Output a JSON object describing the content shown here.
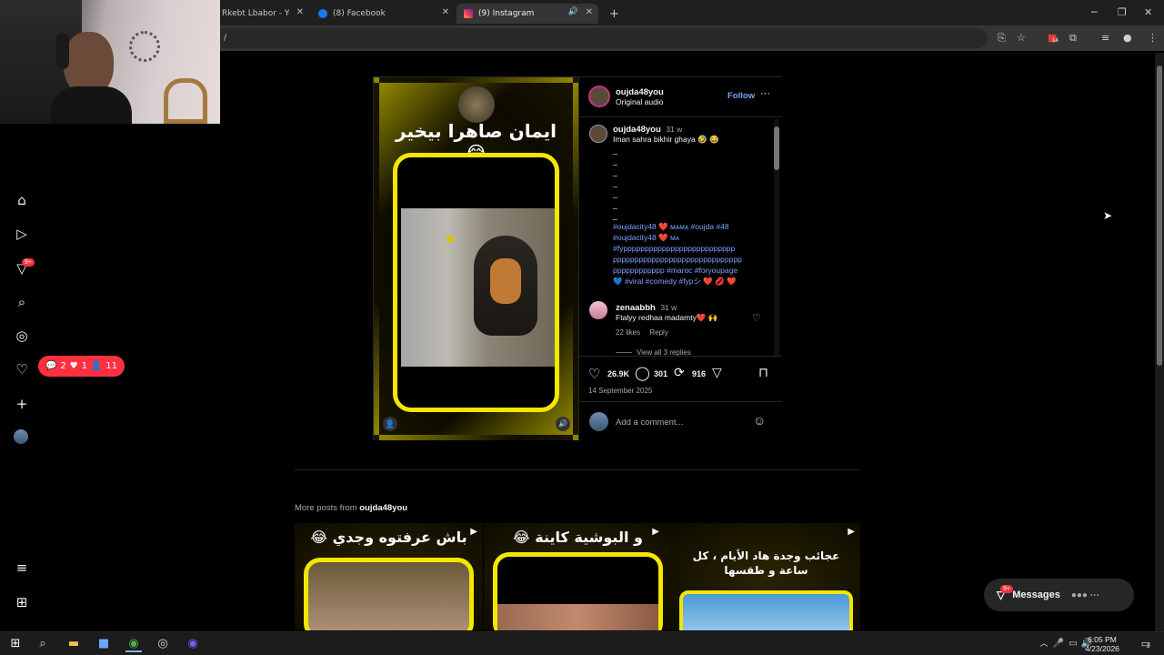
{
  "browser": {
    "tabs": [
      {
        "label": "Rkebt Lbabor - YouTu",
        "icon": "youtube-icon",
        "color": "#ff0000"
      },
      {
        "label": "(8) Facebook",
        "icon": "facebook-icon",
        "color": "#1877f2"
      },
      {
        "label": "(9) Instagram",
        "icon": "instagram-icon",
        "color": "#e1306c"
      }
    ],
    "url": "/",
    "new_tab": "+",
    "extension_badge": "14"
  },
  "sidebar": {
    "notifications_badge": "9+",
    "activity": {
      "comments": "2",
      "likes": "1",
      "follows": "11"
    }
  },
  "reel": {
    "title": "ايمان صاهرا بيخير 😂"
  },
  "post": {
    "username": "oujda48you",
    "audio": "Original audio",
    "follow_label": "Follow",
    "more": "···",
    "caption": {
      "username": "oujda48you",
      "time": "31 w",
      "text": "Iman sahra bikhir ghaya 🤣 😂",
      "dashes": [
        "_",
        "_",
        "_",
        "_",
        "_",
        "_",
        "_"
      ],
      "hashtags_line1": "#oujdacity48 ❤️ ᴍᴀᴍᴀ #oujda #48",
      "hashtags_line2": "#oujdacity48 ❤️ ᴍᴀ",
      "hashtags_line3": "#fypppppppppppppppppppppppppp",
      "hashtags_line4": "pppppppppppppppppppppppppppppp",
      "hashtags_line5": "pppppppppppp #maroc #foryoupage",
      "hashtags_line6": "💙 #viral #comedy #fypシ ❤️ 💋 ❤️"
    },
    "comment": {
      "username": "zenaabbh",
      "time": "31 w",
      "text": "Ftalyy redhaa madamty❤️ 🙌",
      "likes": "22 likes",
      "reply": "Reply",
      "view_replies": "View all 3 replies"
    },
    "stats": {
      "likes": "26.9K",
      "comments": "301",
      "reposts": "916"
    },
    "date": "14 September 2025",
    "add_comment_placeholder": "Add a comment..."
  },
  "more_posts": {
    "heading_prefix": "More posts from ",
    "heading_user": "oujda48you",
    "thumbs": [
      {
        "title": "باش عرفتوه وجدي 😂"
      },
      {
        "title": "و البوشية كاينة 😂"
      },
      {
        "title": "عجائب وجدة هاد الأيام ، كل ساعة و طقسها"
      }
    ]
  },
  "messages": {
    "label": "Messages",
    "badge": "9+"
  },
  "taskbar": {
    "time": "6:05 PM",
    "date": "4/23/2026",
    "notif_count": "3"
  }
}
